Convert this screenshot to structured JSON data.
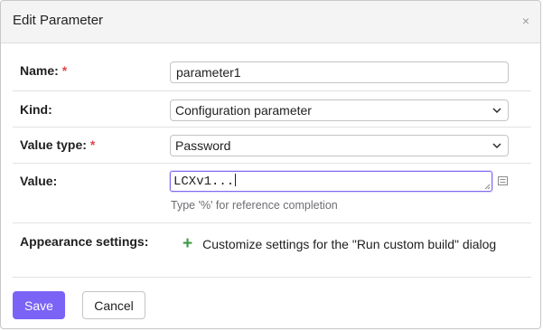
{
  "dialog": {
    "title": "Edit Parameter",
    "close_symbol": "×"
  },
  "fields": {
    "name": {
      "label": "Name:",
      "required_mark": "*",
      "value": "parameter1"
    },
    "kind": {
      "label": "Kind:",
      "selected": "Configuration parameter"
    },
    "value_type": {
      "label": "Value type:",
      "required_mark": "*",
      "selected": "Password"
    },
    "value": {
      "label": "Value:",
      "text": "LCXv1...",
      "hint": "Type '%' for reference completion"
    },
    "appearance": {
      "label": "Appearance settings:",
      "plus_symbol": "+",
      "link_text": "Customize settings for the \"Run custom build\" dialog"
    }
  },
  "footer": {
    "save_label": "Save",
    "cancel_label": "Cancel"
  },
  "colors": {
    "accent": "#7b63f5",
    "required": "#e0484e",
    "plus": "#3b9b45"
  },
  "icons": {
    "close": "close-icon",
    "select_arrow": "chevron-down-icon",
    "value_list": "list-icon",
    "add": "plus-icon"
  }
}
